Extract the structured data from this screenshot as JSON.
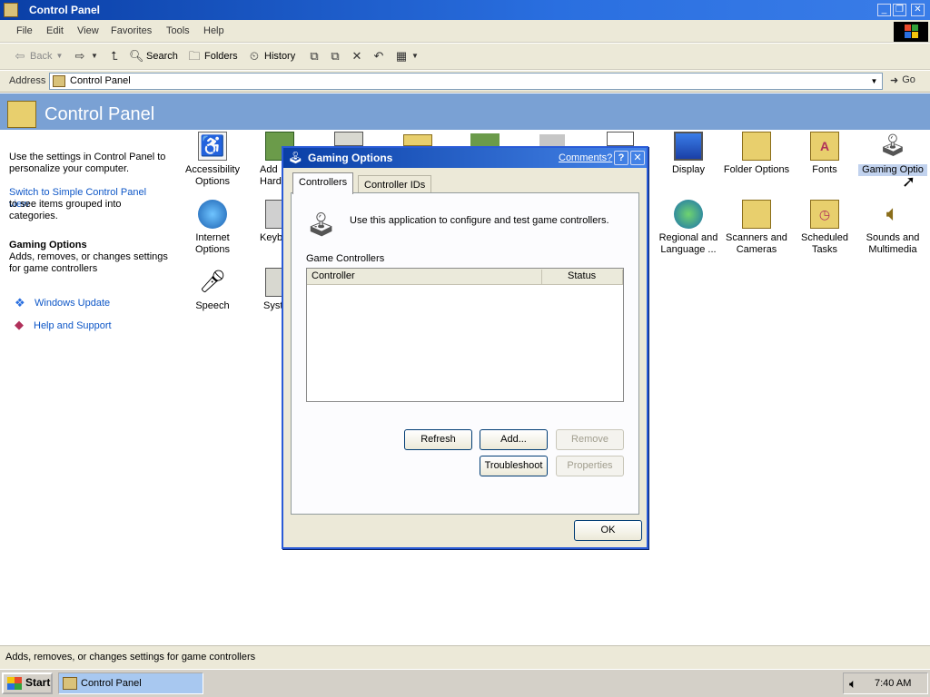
{
  "window": {
    "title": "Control Panel"
  },
  "menu": [
    "File",
    "Edit",
    "View",
    "Favorites",
    "Tools",
    "Help"
  ],
  "toolbar": {
    "back": "Back",
    "search": "Search",
    "folders": "Folders",
    "history": "History"
  },
  "address": {
    "label": "Address",
    "value": "Control Panel",
    "go": "Go"
  },
  "header": {
    "title": "Control Panel"
  },
  "leftpane": {
    "intro": "Use the settings in Control Panel to personalize your computer.",
    "switch_link": "Switch to Simple Control Panel view",
    "switch_rest": "to see items grouped into categories.",
    "selected_title": "Gaming Options",
    "selected_desc": "Adds, removes, or changes settings for game controllers",
    "links": [
      "Windows Update",
      "Help and Support"
    ]
  },
  "items": {
    "accessibility": "Accessibility Options",
    "add_hardware": "Add Hardw",
    "internet": "Internet Options",
    "keyboard": "Keyb",
    "speech": "Speech",
    "system": "Syst",
    "display": "Display",
    "folder_options": "Folder Options",
    "fonts": "Fonts",
    "gaming": "Gaming Optio",
    "regional": "Regional and Language ...",
    "scanners": "Scanners and Cameras",
    "scheduled": "Scheduled Tasks",
    "sounds": "Sounds and Multimedia"
  },
  "statusbar": {
    "text": "Adds, removes, or changes settings for game controllers"
  },
  "taskbar": {
    "start": "Start",
    "task": "Control Panel",
    "clock": "7:40 AM"
  },
  "dialog": {
    "title": "Gaming Options",
    "comments": "Comments?",
    "help": "?",
    "tabs": [
      "Controllers",
      "Controller IDs"
    ],
    "description": "Use this application to configure and test game controllers.",
    "list_label": "Game Controllers",
    "columns": [
      "Controller",
      "Status"
    ],
    "buttons": {
      "refresh": "Refresh",
      "add": "Add...",
      "remove": "Remove",
      "troubleshoot": "Troubleshoot",
      "properties": "Properties",
      "ok": "OK"
    }
  }
}
